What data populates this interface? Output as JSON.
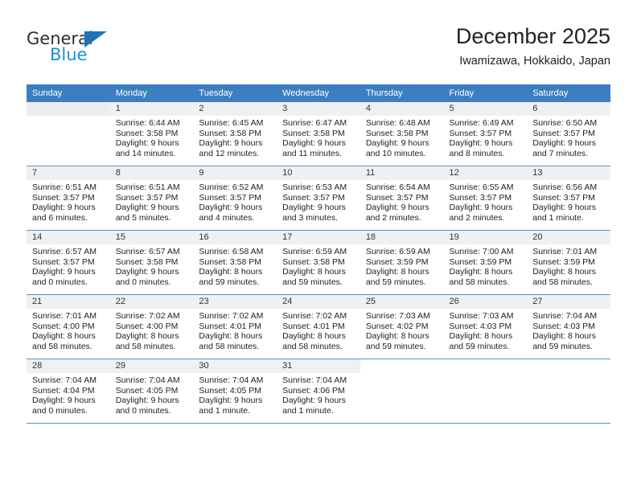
{
  "brand": {
    "name_top": "General",
    "name_bottom": "Blue",
    "accent_color": "#1b75bb",
    "accent_color_light": "#1b8fd6"
  },
  "header": {
    "title": "December 2025",
    "subtitle": "Iwamizawa, Hokkaido, Japan"
  },
  "theme": {
    "header_row_bg": "#3c7fc1",
    "header_row_text": "#ffffff",
    "daynum_bg": "#f0f0f0",
    "divider": "#5b93cb"
  },
  "weekdays": [
    "Sunday",
    "Monday",
    "Tuesday",
    "Wednesday",
    "Thursday",
    "Friday",
    "Saturday"
  ],
  "labels": {
    "sunrise_prefix": "Sunrise:",
    "sunset_prefix": "Sunset:",
    "daylight_prefix": "Daylight:"
  },
  "weeks": [
    [
      {
        "day": "",
        "sunrise": "",
        "sunset": "",
        "daylight_line1": "",
        "daylight_line2": "",
        "empty": true
      },
      {
        "day": "1",
        "sunrise": "Sunrise: 6:44 AM",
        "sunset": "Sunset: 3:58 PM",
        "daylight_line1": "Daylight: 9 hours",
        "daylight_line2": "and 14 minutes."
      },
      {
        "day": "2",
        "sunrise": "Sunrise: 6:45 AM",
        "sunset": "Sunset: 3:58 PM",
        "daylight_line1": "Daylight: 9 hours",
        "daylight_line2": "and 12 minutes."
      },
      {
        "day": "3",
        "sunrise": "Sunrise: 6:47 AM",
        "sunset": "Sunset: 3:58 PM",
        "daylight_line1": "Daylight: 9 hours",
        "daylight_line2": "and 11 minutes."
      },
      {
        "day": "4",
        "sunrise": "Sunrise: 6:48 AM",
        "sunset": "Sunset: 3:58 PM",
        "daylight_line1": "Daylight: 9 hours",
        "daylight_line2": "and 10 minutes."
      },
      {
        "day": "5",
        "sunrise": "Sunrise: 6:49 AM",
        "sunset": "Sunset: 3:57 PM",
        "daylight_line1": "Daylight: 9 hours",
        "daylight_line2": "and 8 minutes."
      },
      {
        "day": "6",
        "sunrise": "Sunrise: 6:50 AM",
        "sunset": "Sunset: 3:57 PM",
        "daylight_line1": "Daylight: 9 hours",
        "daylight_line2": "and 7 minutes."
      }
    ],
    [
      {
        "day": "7",
        "sunrise": "Sunrise: 6:51 AM",
        "sunset": "Sunset: 3:57 PM",
        "daylight_line1": "Daylight: 9 hours",
        "daylight_line2": "and 6 minutes."
      },
      {
        "day": "8",
        "sunrise": "Sunrise: 6:51 AM",
        "sunset": "Sunset: 3:57 PM",
        "daylight_line1": "Daylight: 9 hours",
        "daylight_line2": "and 5 minutes."
      },
      {
        "day": "9",
        "sunrise": "Sunrise: 6:52 AM",
        "sunset": "Sunset: 3:57 PM",
        "daylight_line1": "Daylight: 9 hours",
        "daylight_line2": "and 4 minutes."
      },
      {
        "day": "10",
        "sunrise": "Sunrise: 6:53 AM",
        "sunset": "Sunset: 3:57 PM",
        "daylight_line1": "Daylight: 9 hours",
        "daylight_line2": "and 3 minutes."
      },
      {
        "day": "11",
        "sunrise": "Sunrise: 6:54 AM",
        "sunset": "Sunset: 3:57 PM",
        "daylight_line1": "Daylight: 9 hours",
        "daylight_line2": "and 2 minutes."
      },
      {
        "day": "12",
        "sunrise": "Sunrise: 6:55 AM",
        "sunset": "Sunset: 3:57 PM",
        "daylight_line1": "Daylight: 9 hours",
        "daylight_line2": "and 2 minutes."
      },
      {
        "day": "13",
        "sunrise": "Sunrise: 6:56 AM",
        "sunset": "Sunset: 3:57 PM",
        "daylight_line1": "Daylight: 9 hours",
        "daylight_line2": "and 1 minute."
      }
    ],
    [
      {
        "day": "14",
        "sunrise": "Sunrise: 6:57 AM",
        "sunset": "Sunset: 3:57 PM",
        "daylight_line1": "Daylight: 9 hours",
        "daylight_line2": "and 0 minutes."
      },
      {
        "day": "15",
        "sunrise": "Sunrise: 6:57 AM",
        "sunset": "Sunset: 3:58 PM",
        "daylight_line1": "Daylight: 9 hours",
        "daylight_line2": "and 0 minutes."
      },
      {
        "day": "16",
        "sunrise": "Sunrise: 6:58 AM",
        "sunset": "Sunset: 3:58 PM",
        "daylight_line1": "Daylight: 8 hours",
        "daylight_line2": "and 59 minutes."
      },
      {
        "day": "17",
        "sunrise": "Sunrise: 6:59 AM",
        "sunset": "Sunset: 3:58 PM",
        "daylight_line1": "Daylight: 8 hours",
        "daylight_line2": "and 59 minutes."
      },
      {
        "day": "18",
        "sunrise": "Sunrise: 6:59 AM",
        "sunset": "Sunset: 3:59 PM",
        "daylight_line1": "Daylight: 8 hours",
        "daylight_line2": "and 59 minutes."
      },
      {
        "day": "19",
        "sunrise": "Sunrise: 7:00 AM",
        "sunset": "Sunset: 3:59 PM",
        "daylight_line1": "Daylight: 8 hours",
        "daylight_line2": "and 58 minutes."
      },
      {
        "day": "20",
        "sunrise": "Sunrise: 7:01 AM",
        "sunset": "Sunset: 3:59 PM",
        "daylight_line1": "Daylight: 8 hours",
        "daylight_line2": "and 58 minutes."
      }
    ],
    [
      {
        "day": "21",
        "sunrise": "Sunrise: 7:01 AM",
        "sunset": "Sunset: 4:00 PM",
        "daylight_line1": "Daylight: 8 hours",
        "daylight_line2": "and 58 minutes."
      },
      {
        "day": "22",
        "sunrise": "Sunrise: 7:02 AM",
        "sunset": "Sunset: 4:00 PM",
        "daylight_line1": "Daylight: 8 hours",
        "daylight_line2": "and 58 minutes."
      },
      {
        "day": "23",
        "sunrise": "Sunrise: 7:02 AM",
        "sunset": "Sunset: 4:01 PM",
        "daylight_line1": "Daylight: 8 hours",
        "daylight_line2": "and 58 minutes."
      },
      {
        "day": "24",
        "sunrise": "Sunrise: 7:02 AM",
        "sunset": "Sunset: 4:01 PM",
        "daylight_line1": "Daylight: 8 hours",
        "daylight_line2": "and 58 minutes."
      },
      {
        "day": "25",
        "sunrise": "Sunrise: 7:03 AM",
        "sunset": "Sunset: 4:02 PM",
        "daylight_line1": "Daylight: 8 hours",
        "daylight_line2": "and 59 minutes."
      },
      {
        "day": "26",
        "sunrise": "Sunrise: 7:03 AM",
        "sunset": "Sunset: 4:03 PM",
        "daylight_line1": "Daylight: 8 hours",
        "daylight_line2": "and 59 minutes."
      },
      {
        "day": "27",
        "sunrise": "Sunrise: 7:04 AM",
        "sunset": "Sunset: 4:03 PM",
        "daylight_line1": "Daylight: 8 hours",
        "daylight_line2": "and 59 minutes."
      }
    ],
    [
      {
        "day": "28",
        "sunrise": "Sunrise: 7:04 AM",
        "sunset": "Sunset: 4:04 PM",
        "daylight_line1": "Daylight: 9 hours",
        "daylight_line2": "and 0 minutes."
      },
      {
        "day": "29",
        "sunrise": "Sunrise: 7:04 AM",
        "sunset": "Sunset: 4:05 PM",
        "daylight_line1": "Daylight: 9 hours",
        "daylight_line2": "and 0 minutes."
      },
      {
        "day": "30",
        "sunrise": "Sunrise: 7:04 AM",
        "sunset": "Sunset: 4:05 PM",
        "daylight_line1": "Daylight: 9 hours",
        "daylight_line2": "and 1 minute."
      },
      {
        "day": "31",
        "sunrise": "Sunrise: 7:04 AM",
        "sunset": "Sunset: 4:06 PM",
        "daylight_line1": "Daylight: 9 hours",
        "daylight_line2": "and 1 minute."
      },
      {
        "day": "",
        "sunrise": "",
        "sunset": "",
        "daylight_line1": "",
        "daylight_line2": "",
        "empty": true,
        "blank_white": true
      },
      {
        "day": "",
        "sunrise": "",
        "sunset": "",
        "daylight_line1": "",
        "daylight_line2": "",
        "empty": true,
        "blank_white": true
      },
      {
        "day": "",
        "sunrise": "",
        "sunset": "",
        "daylight_line1": "",
        "daylight_line2": "",
        "empty": true,
        "blank_white": true
      }
    ]
  ]
}
